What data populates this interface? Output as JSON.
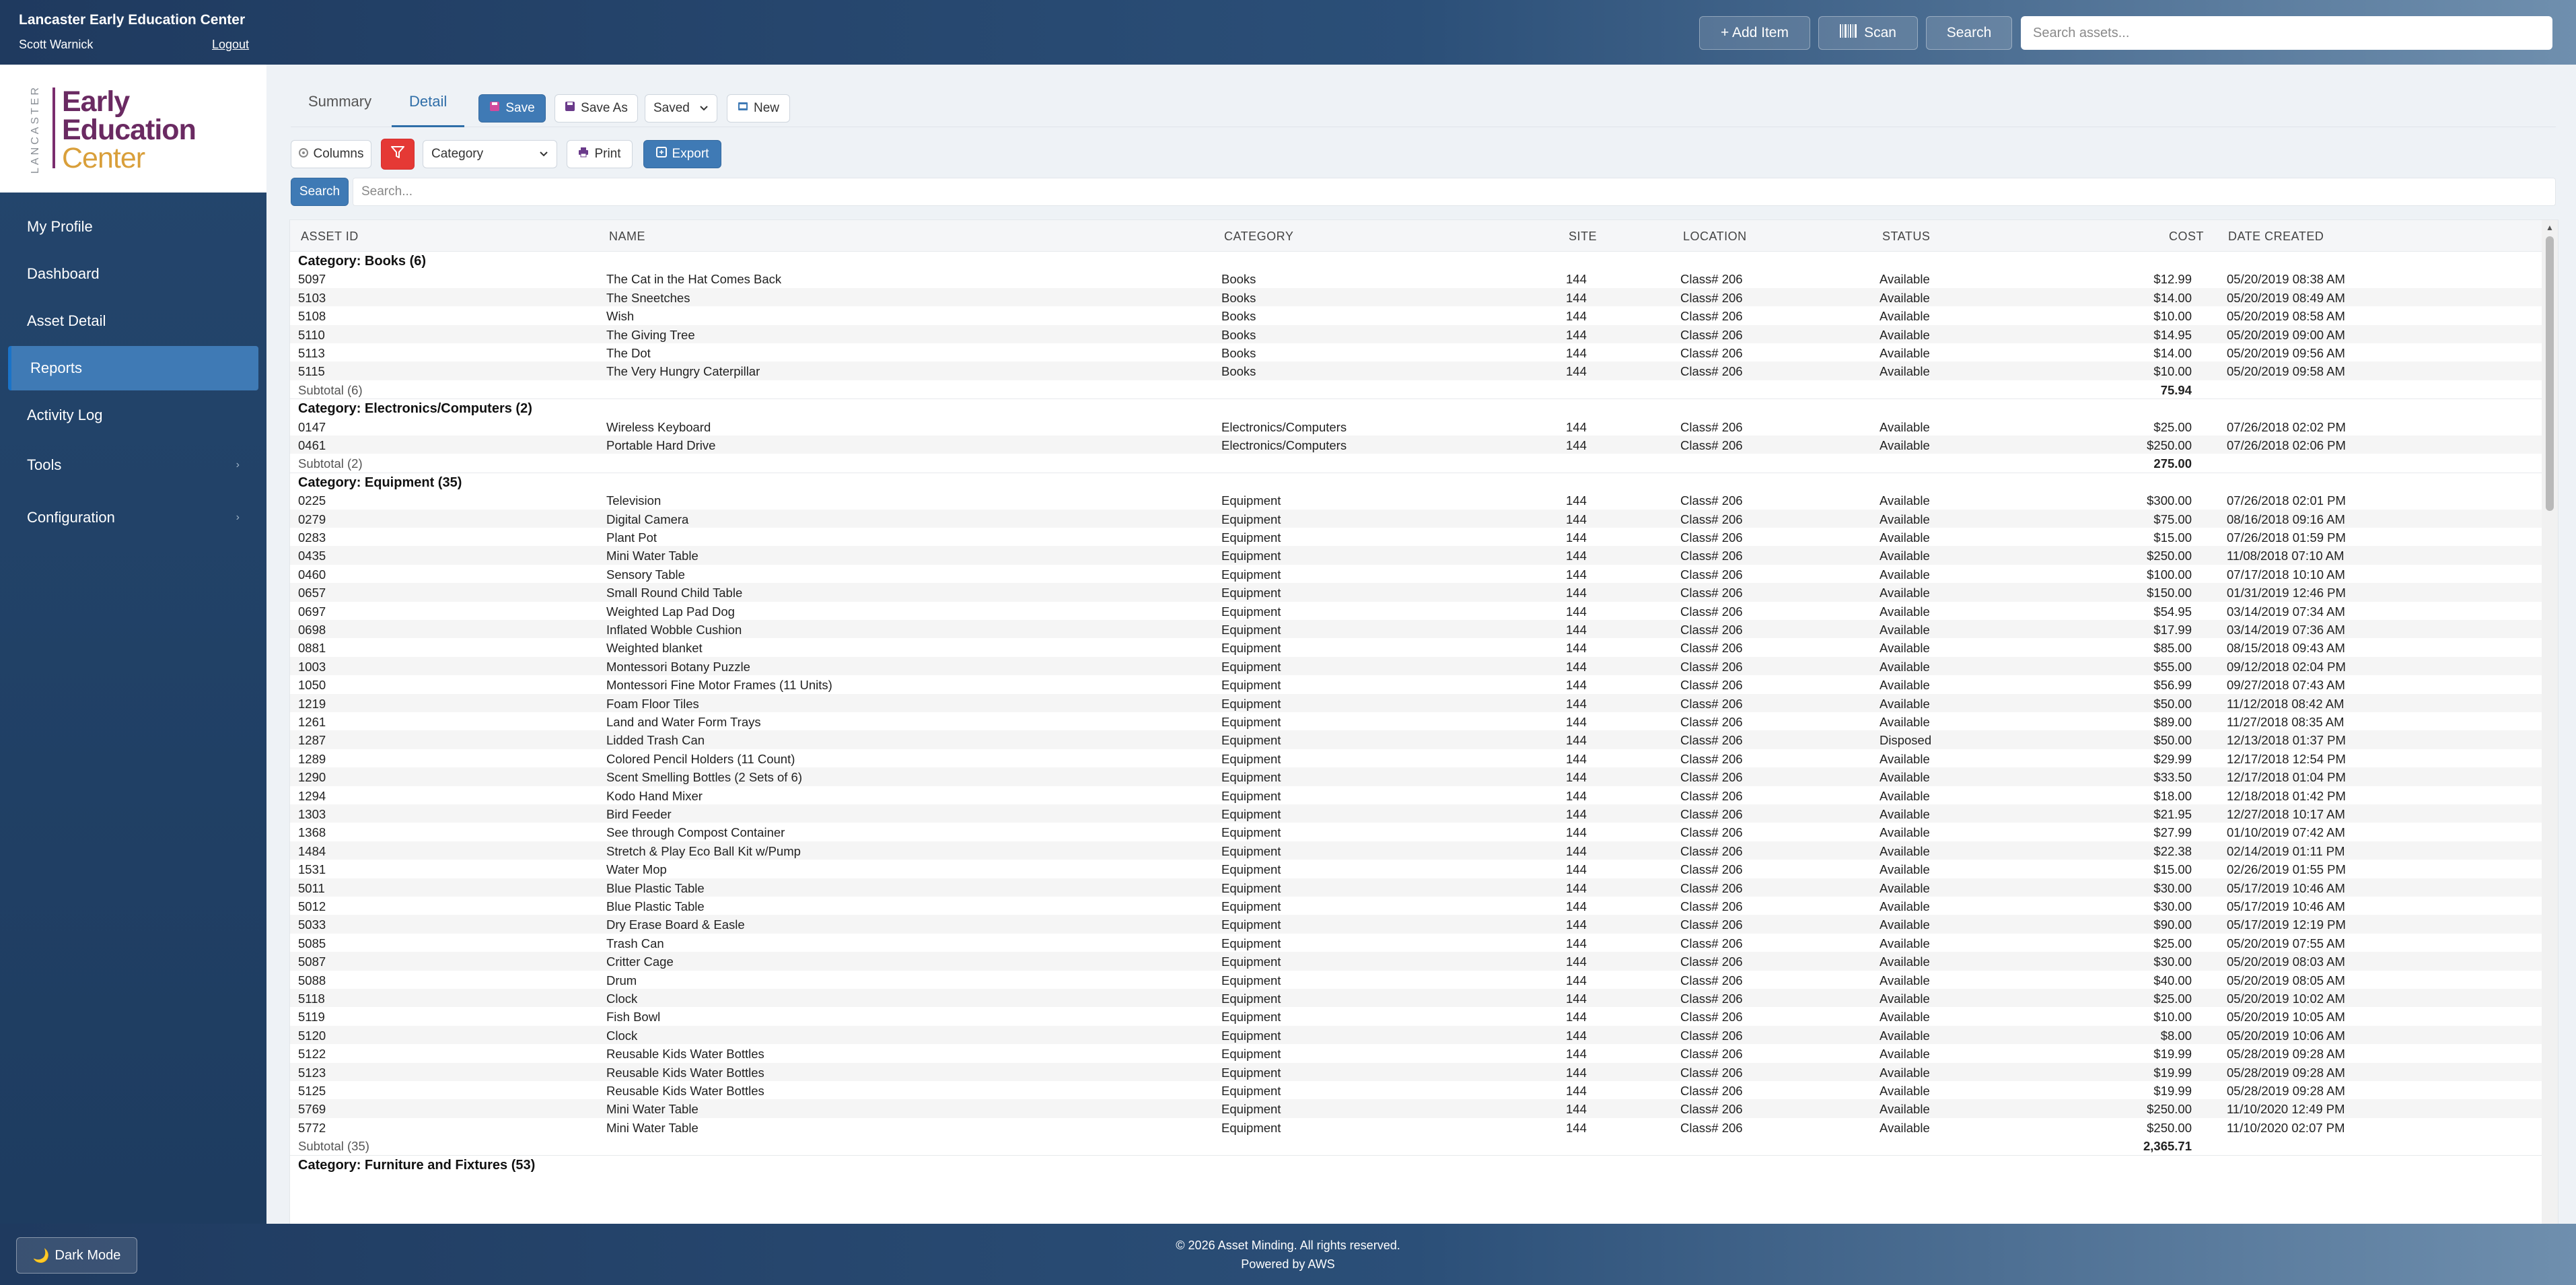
{
  "header": {
    "org_title": "Lancaster Early Education Center",
    "user_name": "Scott Warnick",
    "logout_label": "Logout",
    "add_item_label": "+ Add Item",
    "scan_label": "Scan",
    "search_label": "Search",
    "search_placeholder": "Search assets..."
  },
  "logo": {
    "vertical_text": "LANCASTER",
    "line1": "Early",
    "line2": "Education",
    "line3": "Center"
  },
  "sidebar": {
    "items": [
      {
        "label": "My Profile"
      },
      {
        "label": "Dashboard"
      },
      {
        "label": "Asset Detail"
      },
      {
        "label": "Reports",
        "active": true
      },
      {
        "label": "Activity Log"
      },
      {
        "label": "Tools",
        "chevron": "›"
      },
      {
        "label": "Configuration",
        "chevron": "›"
      }
    ],
    "dark_mode_label": "Dark Mode"
  },
  "tabs": {
    "summary": "Summary",
    "detail": "Detail",
    "active": "Detail"
  },
  "toolbar": {
    "save_label": "Save",
    "save_as_label": "Save As",
    "saved_select": "Saved",
    "new_label": "New",
    "columns_label": "Columns",
    "group_select": "Category",
    "print_label": "Print",
    "export_label": "Export",
    "search_button": "Search",
    "search_placeholder": "Search..."
  },
  "table": {
    "columns": [
      "ASSET ID",
      "NAME",
      "CATEGORY",
      "SITE",
      "LOCATION",
      "STATUS",
      "COST",
      "DATE CREATED"
    ],
    "groups": [
      {
        "title": "Category: Books (6)",
        "rows": [
          [
            "5097",
            "The Cat in the Hat Comes Back",
            "Books",
            "144",
            "Class# 206",
            "Available",
            "$12.99",
            "05/20/2019 08:38 AM"
          ],
          [
            "5103",
            "The Sneetches",
            "Books",
            "144",
            "Class# 206",
            "Available",
            "$14.00",
            "05/20/2019 08:49 AM"
          ],
          [
            "5108",
            "Wish",
            "Books",
            "144",
            "Class# 206",
            "Available",
            "$10.00",
            "05/20/2019 08:58 AM"
          ],
          [
            "5110",
            "The Giving Tree",
            "Books",
            "144",
            "Class# 206",
            "Available",
            "$14.95",
            "05/20/2019 09:00 AM"
          ],
          [
            "5113",
            "The Dot",
            "Books",
            "144",
            "Class# 206",
            "Available",
            "$14.00",
            "05/20/2019 09:56 AM"
          ],
          [
            "5115",
            "The Very Hungry Caterpillar",
            "Books",
            "144",
            "Class# 206",
            "Available",
            "$10.00",
            "05/20/2019 09:58 AM"
          ]
        ],
        "subtotal_label": "Subtotal (6)",
        "subtotal_value": "75.94"
      },
      {
        "title": "Category: Electronics/Computers (2)",
        "rows": [
          [
            "0147",
            "Wireless Keyboard",
            "Electronics/Computers",
            "144",
            "Class# 206",
            "Available",
            "$25.00",
            "07/26/2018 02:02 PM"
          ],
          [
            "0461",
            "Portable Hard Drive",
            "Electronics/Computers",
            "144",
            "Class# 206",
            "Available",
            "$250.00",
            "07/26/2018 02:06 PM"
          ]
        ],
        "subtotal_label": "Subtotal (2)",
        "subtotal_value": "275.00"
      },
      {
        "title": "Category: Equipment (35)",
        "rows": [
          [
            "0225",
            "Television",
            "Equipment",
            "144",
            "Class# 206",
            "Available",
            "$300.00",
            "07/26/2018 02:01 PM"
          ],
          [
            "0279",
            "Digital Camera",
            "Equipment",
            "144",
            "Class# 206",
            "Available",
            "$75.00",
            "08/16/2018 09:16 AM"
          ],
          [
            "0283",
            "Plant Pot",
            "Equipment",
            "144",
            "Class# 206",
            "Available",
            "$15.00",
            "07/26/2018 01:59 PM"
          ],
          [
            "0435",
            "Mini Water Table",
            "Equipment",
            "144",
            "Class# 206",
            "Available",
            "$250.00",
            "11/08/2018 07:10 AM"
          ],
          [
            "0460",
            "Sensory Table",
            "Equipment",
            "144",
            "Class# 206",
            "Available",
            "$100.00",
            "07/17/2018 10:10 AM"
          ],
          [
            "0657",
            "Small Round Child Table",
            "Equipment",
            "144",
            "Class# 206",
            "Available",
            "$150.00",
            "01/31/2019 12:46 PM"
          ],
          [
            "0697",
            "Weighted Lap Pad Dog",
            "Equipment",
            "144",
            "Class# 206",
            "Available",
            "$54.95",
            "03/14/2019 07:34 AM"
          ],
          [
            "0698",
            "Inflated Wobble Cushion",
            "Equipment",
            "144",
            "Class# 206",
            "Available",
            "$17.99",
            "03/14/2019 07:36 AM"
          ],
          [
            "0881",
            "Weighted blanket",
            "Equipment",
            "144",
            "Class# 206",
            "Available",
            "$85.00",
            "08/15/2018 09:43 AM"
          ],
          [
            "1003",
            "Montessori Botany Puzzle",
            "Equipment",
            "144",
            "Class# 206",
            "Available",
            "$55.00",
            "09/12/2018 02:04 PM"
          ],
          [
            "1050",
            "Montessori Fine Motor Frames (11 Units)",
            "Equipment",
            "144",
            "Class# 206",
            "Available",
            "$56.99",
            "09/27/2018 07:43 AM"
          ],
          [
            "1219",
            "Foam Floor Tiles",
            "Equipment",
            "144",
            "Class# 206",
            "Available",
            "$50.00",
            "11/12/2018 08:42 AM"
          ],
          [
            "1261",
            "Land and Water Form Trays",
            "Equipment",
            "144",
            "Class# 206",
            "Available",
            "$89.00",
            "11/27/2018 08:35 AM"
          ],
          [
            "1287",
            "Lidded Trash Can",
            "Equipment",
            "144",
            "Class# 206",
            "Disposed",
            "$50.00",
            "12/13/2018 01:37 PM"
          ],
          [
            "1289",
            "Colored Pencil Holders (11 Count)",
            "Equipment",
            "144",
            "Class# 206",
            "Available",
            "$29.99",
            "12/17/2018 12:54 PM"
          ],
          [
            "1290",
            "Scent Smelling Bottles (2 Sets of 6)",
            "Equipment",
            "144",
            "Class# 206",
            "Available",
            "$33.50",
            "12/17/2018 01:04 PM"
          ],
          [
            "1294",
            "Kodo Hand Mixer",
            "Equipment",
            "144",
            "Class# 206",
            "Available",
            "$18.00",
            "12/18/2018 01:42 PM"
          ],
          [
            "1303",
            "Bird Feeder",
            "Equipment",
            "144",
            "Class# 206",
            "Available",
            "$21.95",
            "12/27/2018 10:17 AM"
          ],
          [
            "1368",
            "See through Compost Container",
            "Equipment",
            "144",
            "Class# 206",
            "Available",
            "$27.99",
            "01/10/2019 07:42 AM"
          ],
          [
            "1484",
            "Stretch & Play Eco Ball Kit w/Pump",
            "Equipment",
            "144",
            "Class# 206",
            "Available",
            "$22.38",
            "02/14/2019 01:11 PM"
          ],
          [
            "1531",
            "Water Mop",
            "Equipment",
            "144",
            "Class# 206",
            "Available",
            "$15.00",
            "02/26/2019 01:55 PM"
          ],
          [
            "5011",
            "Blue Plastic Table",
            "Equipment",
            "144",
            "Class# 206",
            "Available",
            "$30.00",
            "05/17/2019 10:46 AM"
          ],
          [
            "5012",
            "Blue Plastic Table",
            "Equipment",
            "144",
            "Class# 206",
            "Available",
            "$30.00",
            "05/17/2019 10:46 AM"
          ],
          [
            "5033",
            "Dry Erase Board & Easle",
            "Equipment",
            "144",
            "Class# 206",
            "Available",
            "$90.00",
            "05/17/2019 12:19 PM"
          ],
          [
            "5085",
            "Trash Can",
            "Equipment",
            "144",
            "Class# 206",
            "Available",
            "$25.00",
            "05/20/2019 07:55 AM"
          ],
          [
            "5087",
            "Critter Cage",
            "Equipment",
            "144",
            "Class# 206",
            "Available",
            "$30.00",
            "05/20/2019 08:03 AM"
          ],
          [
            "5088",
            "Drum",
            "Equipment",
            "144",
            "Class# 206",
            "Available",
            "$40.00",
            "05/20/2019 08:05 AM"
          ],
          [
            "5118",
            "Clock",
            "Equipment",
            "144",
            "Class# 206",
            "Available",
            "$25.00",
            "05/20/2019 10:02 AM"
          ],
          [
            "5119",
            "Fish Bowl",
            "Equipment",
            "144",
            "Class# 206",
            "Available",
            "$10.00",
            "05/20/2019 10:05 AM"
          ],
          [
            "5120",
            "Clock",
            "Equipment",
            "144",
            "Class# 206",
            "Available",
            "$8.00",
            "05/20/2019 10:06 AM"
          ],
          [
            "5122",
            "Reusable Kids Water Bottles",
            "Equipment",
            "144",
            "Class# 206",
            "Available",
            "$19.99",
            "05/28/2019 09:28 AM"
          ],
          [
            "5123",
            "Reusable Kids Water Bottles",
            "Equipment",
            "144",
            "Class# 206",
            "Available",
            "$19.99",
            "05/28/2019 09:28 AM"
          ],
          [
            "5125",
            "Reusable Kids Water Bottles",
            "Equipment",
            "144",
            "Class# 206",
            "Available",
            "$19.99",
            "05/28/2019 09:28 AM"
          ],
          [
            "5769",
            "Mini Water Table",
            "Equipment",
            "144",
            "Class# 206",
            "Available",
            "$250.00",
            "11/10/2020 12:49 PM"
          ],
          [
            "5772",
            "Mini Water Table",
            "Equipment",
            "144",
            "Class# 206",
            "Available",
            "$250.00",
            "11/10/2020 02:07 PM"
          ]
        ],
        "subtotal_label": "Subtotal (35)",
        "subtotal_value": "2,365.71"
      },
      {
        "title": "Category: Furniture and Fixtures (53)",
        "rows": [],
        "subtotal_label": "",
        "subtotal_value": ""
      }
    ]
  },
  "footer": {
    "copyright": "© 2026 Asset Minding. All rights reserved.",
    "powered": "Powered by AWS"
  }
}
